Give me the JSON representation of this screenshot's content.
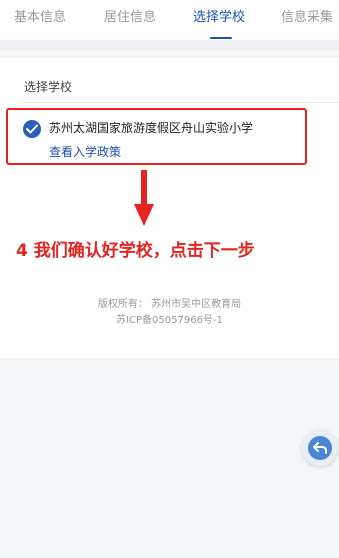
{
  "tabs": [
    {
      "label": "基本信息",
      "active": false
    },
    {
      "label": "居住信息",
      "active": false
    },
    {
      "label": "选择学校",
      "active": true
    },
    {
      "label": "信息采集",
      "active": false
    }
  ],
  "section": {
    "title": "选择学校"
  },
  "school": {
    "name": "苏州太湖国家旅游度假区舟山实验小学",
    "policy_link": "查看入学政策",
    "selected": true
  },
  "annotation": {
    "text": "4  我们确认好学校，点击下一步"
  },
  "footer": {
    "copyright": "版权所有：  苏州市吴中区教育局",
    "icp": "苏ICP备05057966号-1"
  },
  "icons": {
    "radio": "check-icon",
    "fab": "back-arrow-icon",
    "annotation_arrow": "down-arrow-icon"
  },
  "colors": {
    "accent": "#1f4fb6",
    "annotation": "#e8231f",
    "radio": "#2a5fb8"
  }
}
